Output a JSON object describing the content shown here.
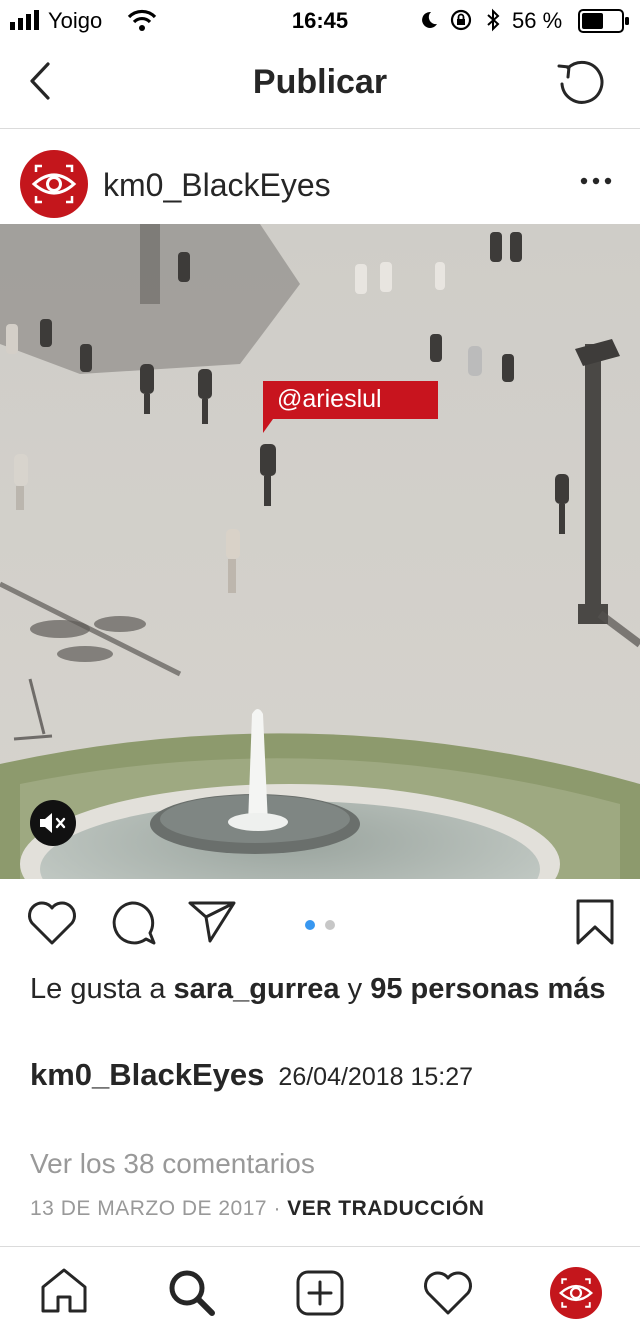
{
  "status_bar": {
    "carrier": "Yoigo",
    "time": "16:45",
    "battery_percent": "56 %",
    "battery_level": 0.56
  },
  "header": {
    "title": "Publicar"
  },
  "post": {
    "username": "km0_BlackEyes",
    "tag_label": "@arieslul",
    "carousel_index": 1,
    "carousel_count": 2,
    "likes": {
      "prefix": "Le gusta a ",
      "liker": "sara_gurrea",
      "middle": " y ",
      "count_text": "95 personas más"
    },
    "caption": {
      "username": "km0_BlackEyes",
      "text": "26/04/2018 15:27"
    },
    "comments_link": "Ver los 38 comentarios",
    "date": "13 DE MARZO DE 2017",
    "separator": "·",
    "translate": "VER TRADUCCIÓN"
  },
  "colors": {
    "brand_red": "#c4161c",
    "tag_red": "#c8141e",
    "dot_active": "#3897f0",
    "dot_inactive": "#c7c7c7",
    "secondary_text": "#999999"
  },
  "icons": {
    "back": "chevron-left-icon",
    "refresh": "refresh-icon",
    "more": "more-options-icon",
    "mute": "mute-icon",
    "like": "heart-icon",
    "comment": "comment-icon",
    "share": "send-icon",
    "save": "bookmark-icon",
    "home": "home-icon",
    "search": "search-icon",
    "add": "add-icon",
    "activity": "heart-icon",
    "profile": "profile-icon"
  }
}
